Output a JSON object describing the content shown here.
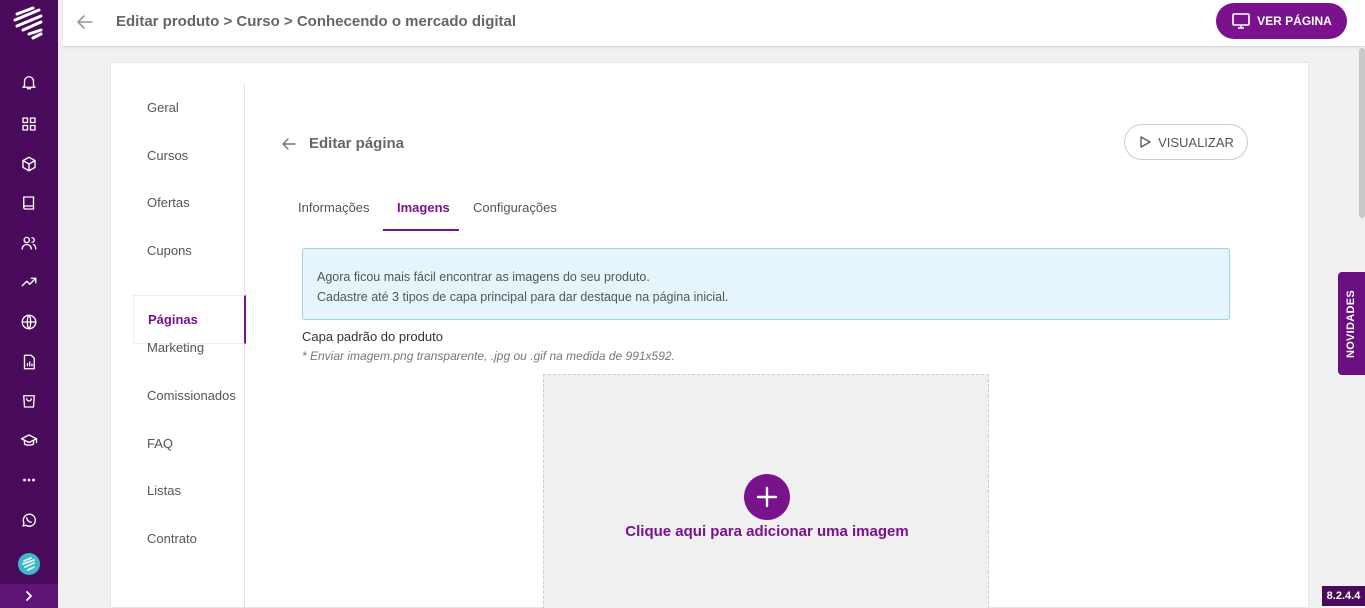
{
  "header": {
    "breadcrumb": "Editar produto > Curso > Conhecendo o mercado digital",
    "ver_pagina_label": "VER PÁGINA"
  },
  "rail": {
    "icons": [
      "bell-icon",
      "grid-icon",
      "box-icon",
      "book-icon",
      "users-icon",
      "trending-up-icon",
      "globe-icon",
      "report-icon",
      "shopping-bag-icon",
      "graduation-cap-icon",
      "more-icon",
      "whatsapp-icon"
    ],
    "expand_icon": "chevron-right-icon"
  },
  "sidenav": {
    "items": [
      {
        "label": "Geral"
      },
      {
        "label": "Cursos"
      },
      {
        "label": "Ofertas"
      },
      {
        "label": "Cupons"
      },
      {
        "label": "Páginas"
      },
      {
        "label": "Marketing"
      },
      {
        "label": "Comissionados"
      },
      {
        "label": "FAQ"
      },
      {
        "label": "Listas"
      },
      {
        "label": "Contrato"
      }
    ],
    "active": "Páginas"
  },
  "section": {
    "title": "Editar página",
    "visualizar_label": "VISUALIZAR"
  },
  "tabs": [
    {
      "label": "Informações"
    },
    {
      "label": "Imagens"
    },
    {
      "label": "Configurações"
    }
  ],
  "active_tab": "Imagens",
  "info_box": {
    "line1": "Agora ficou mais fácil encontrar as imagens do seu produto.",
    "line2": "Cadastre até 3 tipos de capa principal para dar destaque na página inicial."
  },
  "cover": {
    "label": "Capa padrão do produto",
    "hint": "* Enviar imagem.png transparente, .jpg ou .gif na medida de 991x592.",
    "upload_text": "Clique aqui para adicionar uma imagem"
  },
  "novidades_label": "NOVIDADES",
  "version": "8.2.4.4",
  "colors": {
    "brand": "#7a128e",
    "rail": "#4a0a5c",
    "info_bg": "#e6f5fb"
  }
}
